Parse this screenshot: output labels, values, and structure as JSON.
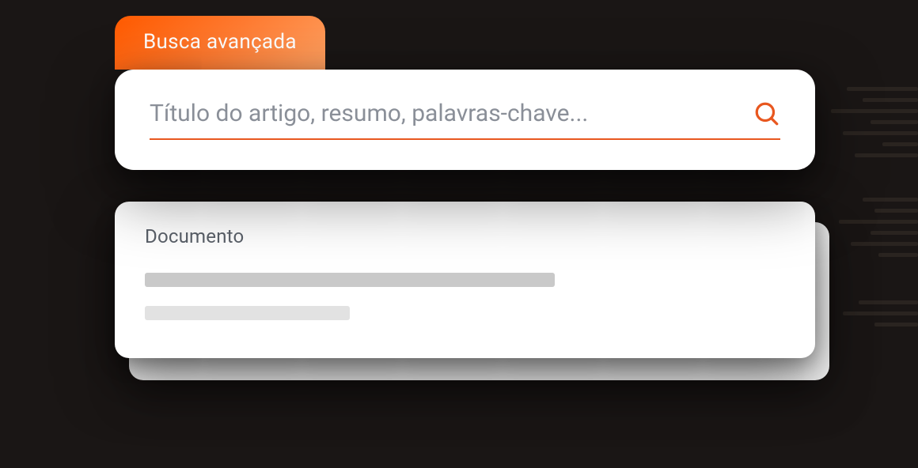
{
  "tab": {
    "label": "Busca avançada"
  },
  "search": {
    "placeholder": "Título do artigo, resumo, palavras-chave...",
    "icon": "search-icon"
  },
  "result": {
    "type_label": "Documento"
  },
  "colors": {
    "accent": "#e8571f",
    "tab_gradient_start": "#ff5a00",
    "tab_gradient_end": "#ffa060"
  }
}
